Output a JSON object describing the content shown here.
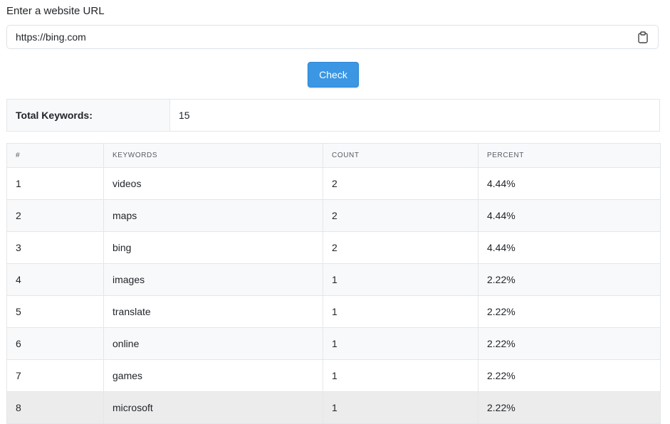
{
  "form": {
    "label": "Enter a website URL",
    "url_value": "https://bing.com",
    "clipboard_icon": "clipboard-icon",
    "check_label": "Check"
  },
  "summary": {
    "label": "Total Keywords:",
    "value": "15"
  },
  "table": {
    "headers": [
      "#",
      "KEYWORDS",
      "COUNT",
      "PERCENT"
    ],
    "rows": [
      {
        "index": "1",
        "keyword": "videos",
        "count": "2",
        "percent": "4.44%"
      },
      {
        "index": "2",
        "keyword": "maps",
        "count": "2",
        "percent": "4.44%"
      },
      {
        "index": "3",
        "keyword": "bing",
        "count": "2",
        "percent": "4.44%"
      },
      {
        "index": "4",
        "keyword": "images",
        "count": "1",
        "percent": "2.22%"
      },
      {
        "index": "5",
        "keyword": "translate",
        "count": "1",
        "percent": "2.22%"
      },
      {
        "index": "6",
        "keyword": "online",
        "count": "1",
        "percent": "2.22%"
      },
      {
        "index": "7",
        "keyword": "games",
        "count": "1",
        "percent": "2.22%"
      },
      {
        "index": "8",
        "keyword": "microsoft",
        "count": "1",
        "percent": "2.22%"
      }
    ]
  },
  "colors": {
    "button": "#3b96e3",
    "border": "#e3e6ea",
    "stripe": "#f8f9fa",
    "hover_row": "#ececec"
  }
}
